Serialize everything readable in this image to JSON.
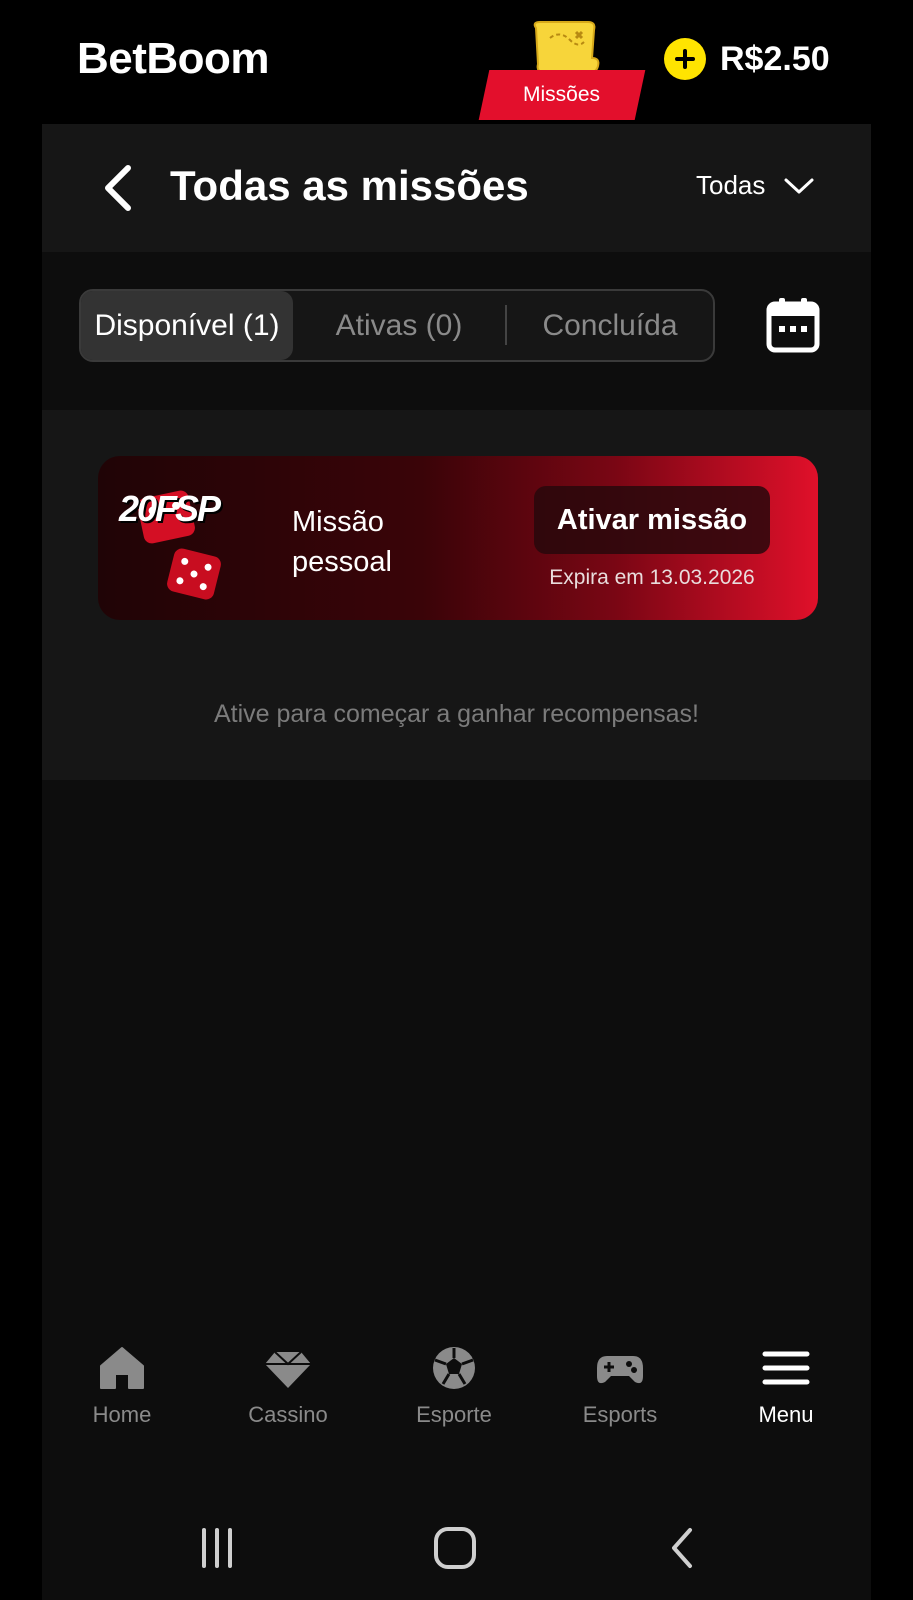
{
  "topbar": {
    "brand": "BetBoom",
    "missions_badge": "Missões",
    "balance": "R$2.50",
    "accent_yellow": "#ffe400",
    "accent_red": "#e30f2c"
  },
  "header": {
    "title": "Todas as missões",
    "filter_label": "Todas"
  },
  "tabs": [
    {
      "label": "Disponível (1)",
      "active": true
    },
    {
      "label": "Ativas (0)",
      "active": false
    },
    {
      "label": "Concluída",
      "active": false
    }
  ],
  "mission": {
    "promo_text": "20FSP",
    "name": "Missão pessoal",
    "activate_label": "Ativar missão",
    "expiry": "Expira em 13.03.2026"
  },
  "hint": "Ative para começar a ganhar recompensas!",
  "nav": [
    {
      "label": "Home",
      "icon": "home-icon"
    },
    {
      "label": "Cassino",
      "icon": "diamond-icon"
    },
    {
      "label": "Esporte",
      "icon": "soccer-ball-icon"
    },
    {
      "label": "Esports",
      "icon": "gamepad-icon"
    },
    {
      "label": "Menu",
      "icon": "hamburger-menu-icon",
      "active": true
    }
  ]
}
